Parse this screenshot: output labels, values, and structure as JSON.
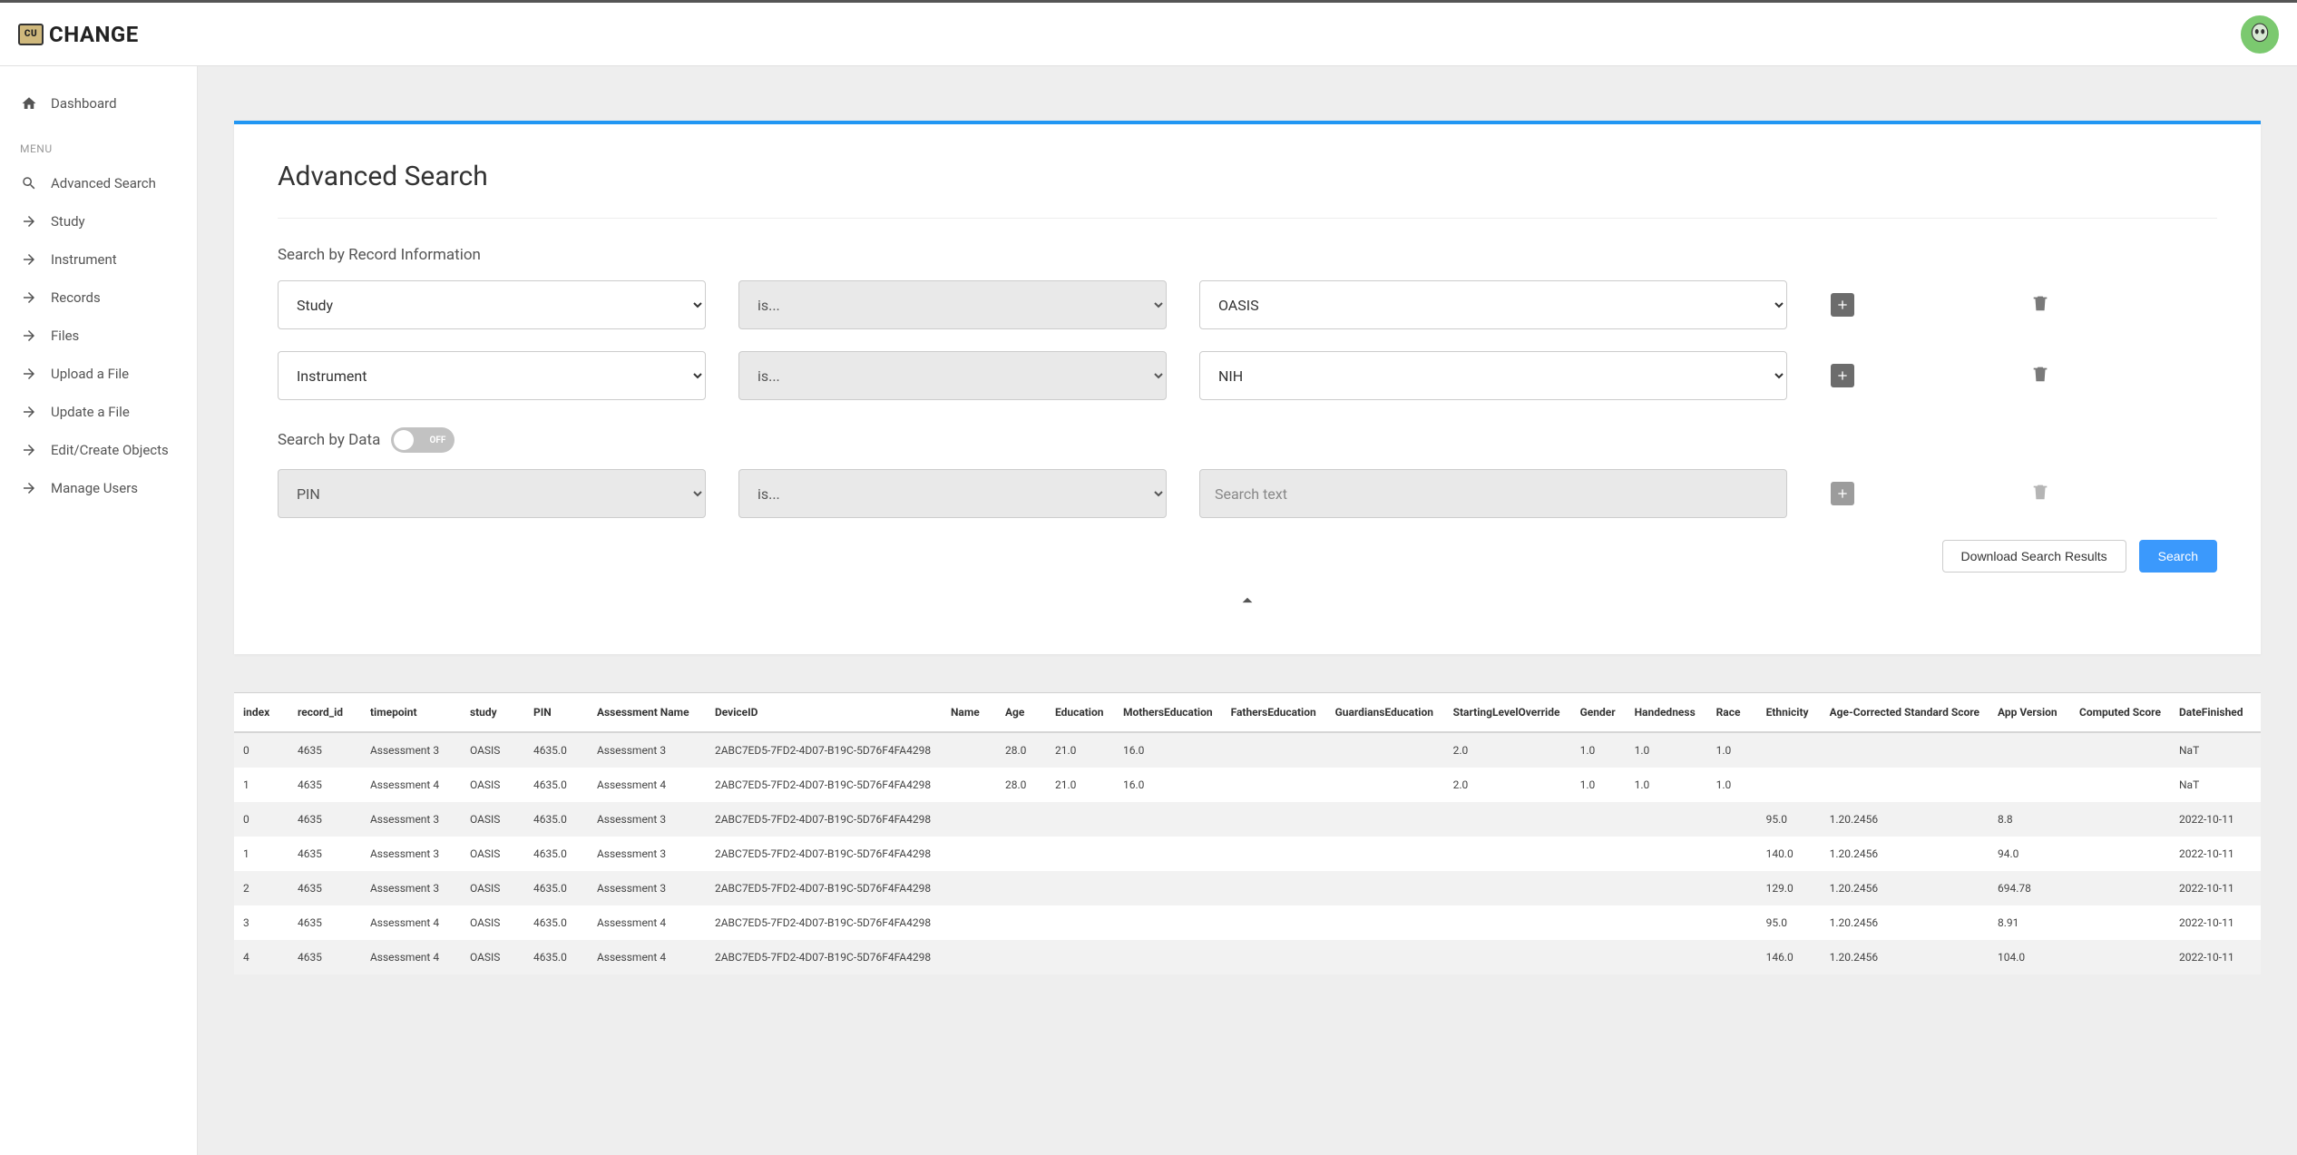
{
  "header": {
    "brand": "CHANGE"
  },
  "sidebar": {
    "dashboard": "Dashboard",
    "menu_label": "MENU",
    "items": [
      "Advanced Search",
      "Study",
      "Instrument",
      "Records",
      "Files",
      "Upload a File",
      "Update a File",
      "Edit/Create Objects",
      "Manage Users"
    ]
  },
  "page": {
    "title": "Advanced Search",
    "search_record_label": "Search by Record Information",
    "search_data_label": "Search by Data",
    "toggle_text": "OFF",
    "download_btn": "Download Search Results",
    "search_btn": "Search"
  },
  "filters": {
    "rows": [
      {
        "field": "Study",
        "op": "is...",
        "value": "OASIS",
        "value_type": "select",
        "disabled_field": false,
        "muted_icons": false
      },
      {
        "field": "Instrument",
        "op": "is...",
        "value": "NIH",
        "value_type": "select",
        "disabled_field": false,
        "muted_icons": false
      }
    ],
    "data_row": {
      "field": "PIN",
      "op": "is...",
      "placeholder": "Search text",
      "disabled_field": true,
      "muted_icons": true
    }
  },
  "results": {
    "columns": [
      "index",
      "record_id",
      "timepoint",
      "study",
      "PIN",
      "Assessment Name",
      "DeviceID",
      "Name",
      "Age",
      "Education",
      "MothersEducation",
      "FathersEducation",
      "GuardiansEducation",
      "StartingLevelOverride",
      "Gender",
      "Handedness",
      "Race",
      "Ethnicity",
      "Age-Corrected Standard Score",
      "App Version",
      "Computed Score",
      "DateFinished"
    ],
    "rows": [
      [
        "0",
        "4635",
        "Assessment 3",
        "OASIS",
        "4635.0",
        "Assessment 3",
        "2ABC7ED5-7FD2-4D07-B19C-5D76F4FA4298",
        "",
        "28.0",
        "21.0",
        "16.0",
        "",
        "",
        "2.0",
        "1.0",
        "1.0",
        "1.0",
        "",
        "",
        "",
        "",
        "NaT"
      ],
      [
        "1",
        "4635",
        "Assessment 4",
        "OASIS",
        "4635.0",
        "Assessment 4",
        "2ABC7ED5-7FD2-4D07-B19C-5D76F4FA4298",
        "",
        "28.0",
        "21.0",
        "16.0",
        "",
        "",
        "2.0",
        "1.0",
        "1.0",
        "1.0",
        "",
        "",
        "",
        "",
        "NaT"
      ],
      [
        "0",
        "4635",
        "Assessment 3",
        "OASIS",
        "4635.0",
        "Assessment 3",
        "2ABC7ED5-7FD2-4D07-B19C-5D76F4FA4298",
        "",
        "",
        "",
        "",
        "",
        "",
        "",
        "",
        "",
        "",
        "95.0",
        "1.20.2456",
        "8.8",
        "",
        "2022-10-11"
      ],
      [
        "1",
        "4635",
        "Assessment 3",
        "OASIS",
        "4635.0",
        "Assessment 3",
        "2ABC7ED5-7FD2-4D07-B19C-5D76F4FA4298",
        "",
        "",
        "",
        "",
        "",
        "",
        "",
        "",
        "",
        "",
        "140.0",
        "1.20.2456",
        "94.0",
        "",
        "2022-10-11"
      ],
      [
        "2",
        "4635",
        "Assessment 3",
        "OASIS",
        "4635.0",
        "Assessment 3",
        "2ABC7ED5-7FD2-4D07-B19C-5D76F4FA4298",
        "",
        "",
        "",
        "",
        "",
        "",
        "",
        "",
        "",
        "",
        "129.0",
        "1.20.2456",
        "694.78",
        "",
        "2022-10-11"
      ],
      [
        "3",
        "4635",
        "Assessment 4",
        "OASIS",
        "4635.0",
        "Assessment 4",
        "2ABC7ED5-7FD2-4D07-B19C-5D76F4FA4298",
        "",
        "",
        "",
        "",
        "",
        "",
        "",
        "",
        "",
        "",
        "95.0",
        "1.20.2456",
        "8.91",
        "",
        "2022-10-11"
      ],
      [
        "4",
        "4635",
        "Assessment 4",
        "OASIS",
        "4635.0",
        "Assessment 4",
        "2ABC7ED5-7FD2-4D07-B19C-5D76F4FA4298",
        "",
        "",
        "",
        "",
        "",
        "",
        "",
        "",
        "",
        "",
        "146.0",
        "1.20.2456",
        "104.0",
        "",
        "2022-10-11"
      ]
    ]
  }
}
